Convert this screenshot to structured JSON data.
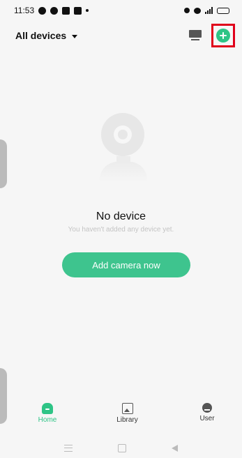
{
  "status_bar": {
    "time": "11:53"
  },
  "header": {
    "device_selector": "All devices"
  },
  "empty_state": {
    "title": "No device",
    "subtitle": "You haven't added any device yet.",
    "cta_label": "Add camera now"
  },
  "tabs": [
    {
      "label": "Home",
      "icon": "home-icon",
      "active": true
    },
    {
      "label": "Library",
      "icon": "image-icon",
      "active": false
    },
    {
      "label": "User",
      "icon": "user-icon",
      "active": false
    }
  ],
  "colors": {
    "accent": "#2ec486",
    "cta": "#3ec48e",
    "highlight": "#e0001b"
  }
}
